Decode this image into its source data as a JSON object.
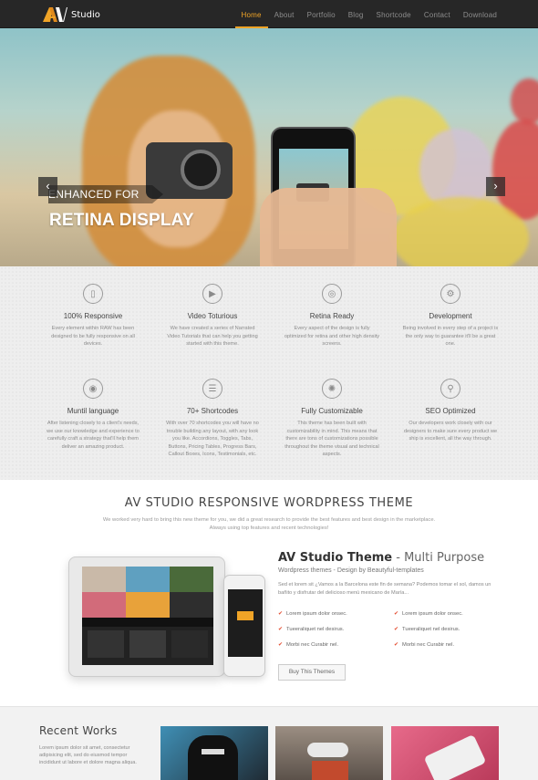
{
  "brand": {
    "mark": "AV",
    "name": "Studio"
  },
  "nav": {
    "items": [
      "Home",
      "About",
      "Portfolio",
      "Blog",
      "Shortcode",
      "Contact",
      "Download"
    ],
    "active": "Home"
  },
  "hero": {
    "label": "ENHANCED FOR",
    "title": "RETINA DISPLAY",
    "prev_icon": "chevron-left-icon",
    "next_icon": "chevron-right-icon"
  },
  "features": [
    {
      "icon": "mobile-icon",
      "glyph": "▯",
      "title": "100% Responsive",
      "text": "Every element within RAW has been designed to be fully responsive on all devices."
    },
    {
      "icon": "play-icon",
      "glyph": "▶",
      "title": "Video Toturious",
      "text": "We have created a series of Narrated Video Tutorials that can help you getting started with this theme."
    },
    {
      "icon": "retina-icon",
      "glyph": "◎",
      "title": "Retina Ready",
      "text": "Every aspect of the design is fully optimized for retina and other high density screens."
    },
    {
      "icon": "development-icon",
      "glyph": "⚙",
      "title": "Development",
      "text": "Being involved in every step of a project is the only way to guarantee it'll be a great one."
    },
    {
      "icon": "globe-icon",
      "glyph": "◉",
      "title": "Muntil language",
      "text": "After listening closely to a client's needs, we use our knowledge and experience to carefully craft a strategy that'll help them deliver an amazing product."
    },
    {
      "icon": "list-icon",
      "glyph": "☰",
      "title": "70+ Shortcodes",
      "text": "With over 70 shortcodes you will have no trouble building any layout, with any look you like. Accordions, Toggles, Tabs, Buttons, Pricing Tables, Progress Bars, Callout Boxes, Icons, Testimonials, etc."
    },
    {
      "icon": "gear-icon",
      "glyph": "✺",
      "title": "Fully Customizable",
      "text": "This theme has been built with customizability in mind. This means that there are tons of customizations possible throughout the theme visual and technical aspects."
    },
    {
      "icon": "search-icon",
      "glyph": "⚲",
      "title": "SEO Optimized",
      "text": "Our developers work closely with our designers to make sure every product we ship is excellent, all the way through."
    }
  ],
  "about": {
    "title": "AV STUDIO RESPONSIVE WORDPRESS THEME",
    "subtitle": "We worked very hard to bring this new theme for you, we did a great research to provide the best features and best design in the marketplace. Always using top features and recent technologies!",
    "theme_name": "AV Studio Theme",
    "theme_tag": " - Multi Purpose",
    "theme_sub": "Wordpress themes - Design by Beautyful-templates",
    "theme_desc": "Sed et lorem sit ¿Vamos a la Barcelona este fin de semana? Podemos tomar el sol, damos un bañito y disfrutar del delicioso menú mexicano de María...",
    "checks_left": [
      "Lorem ipsum dolor onsec.",
      "Tueeraliquet nel desirus.",
      "Morbi nec Curabir nel."
    ],
    "checks_right": [
      "Lorem ipsum dolor onsec.",
      "Tueeraliquet nel desirus.",
      "Morbi nec Curabir nel."
    ],
    "buy_label": "Buy This Themes"
  },
  "works": {
    "title": "Recent Works",
    "text": "Lorem ipsum dolor sit amet, consectetur adipisicing elit, sed do eiusmod tempor incididunt ut labore et dolore magna aliqua."
  },
  "colors": {
    "accent": "#f0a427",
    "nav_bg": "#272727",
    "check": "#e34b2f"
  }
}
